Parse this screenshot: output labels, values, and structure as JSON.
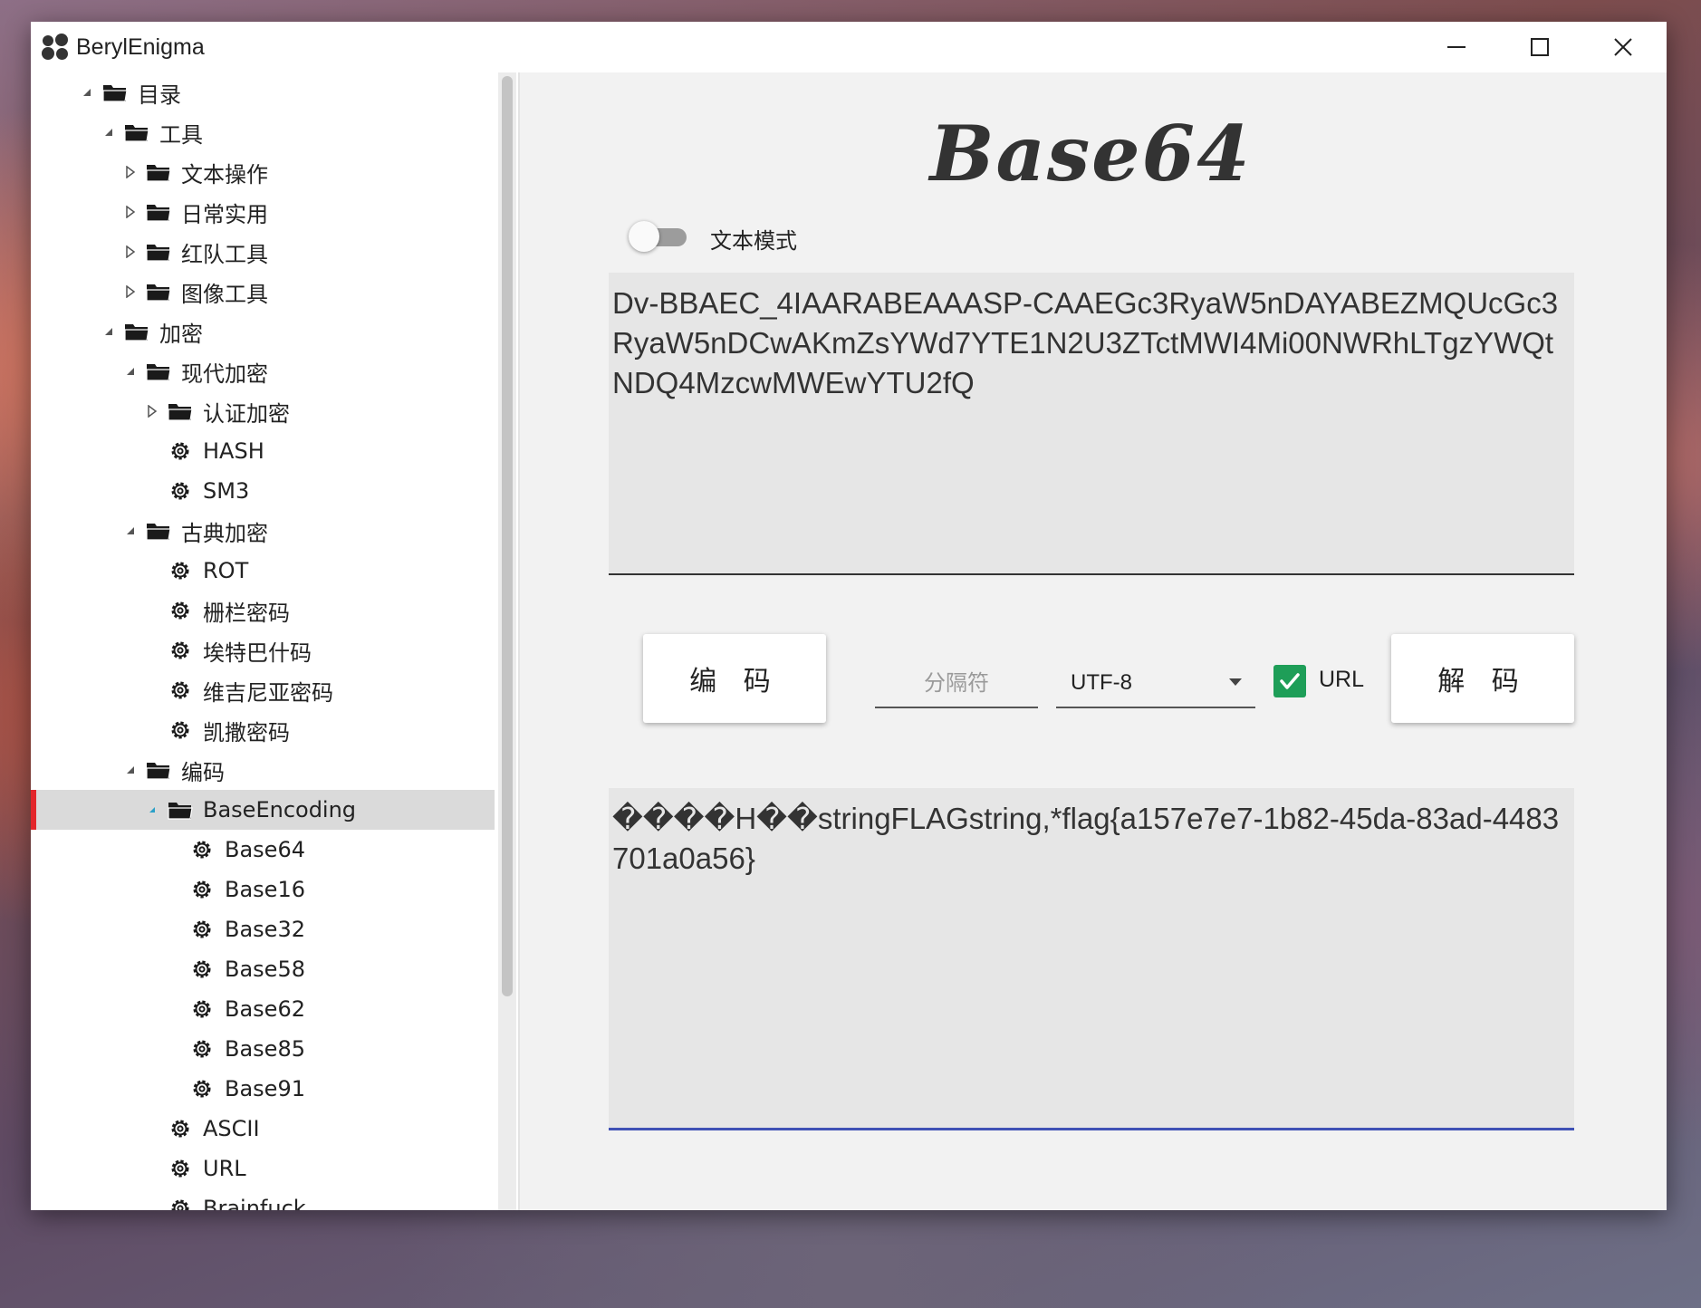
{
  "app": {
    "title": "BerylEnigma"
  },
  "sidebar": {
    "tree": [
      {
        "label": "目录",
        "depth": 0,
        "kind": "folder",
        "expander": "expanded"
      },
      {
        "label": "工具",
        "depth": 1,
        "kind": "folder",
        "expander": "expanded"
      },
      {
        "label": "文本操作",
        "depth": 2,
        "kind": "folder",
        "expander": "collapsed"
      },
      {
        "label": "日常实用",
        "depth": 2,
        "kind": "folder",
        "expander": "collapsed"
      },
      {
        "label": "红队工具",
        "depth": 2,
        "kind": "folder",
        "expander": "collapsed"
      },
      {
        "label": "图像工具",
        "depth": 2,
        "kind": "folder",
        "expander": "collapsed"
      },
      {
        "label": "加密",
        "depth": 1,
        "kind": "folder",
        "expander": "expanded"
      },
      {
        "label": "现代加密",
        "depth": 2,
        "kind": "folder",
        "expander": "expanded"
      },
      {
        "label": "认证加密",
        "depth": 3,
        "kind": "folder",
        "expander": "collapsed"
      },
      {
        "label": "HASH",
        "depth": 3,
        "kind": "tool",
        "expander": "none"
      },
      {
        "label": "SM3",
        "depth": 3,
        "kind": "tool",
        "expander": "none"
      },
      {
        "label": "古典加密",
        "depth": 2,
        "kind": "folder",
        "expander": "expanded"
      },
      {
        "label": "ROT",
        "depth": 3,
        "kind": "tool",
        "expander": "none"
      },
      {
        "label": "栅栏密码",
        "depth": 3,
        "kind": "tool",
        "expander": "none"
      },
      {
        "label": "埃特巴什码",
        "depth": 3,
        "kind": "tool",
        "expander": "none"
      },
      {
        "label": "维吉尼亚密码",
        "depth": 3,
        "kind": "tool",
        "expander": "none"
      },
      {
        "label": "凯撒密码",
        "depth": 3,
        "kind": "tool",
        "expander": "none"
      },
      {
        "label": "编码",
        "depth": 2,
        "kind": "folder",
        "expander": "expanded"
      },
      {
        "label": "BaseEncoding",
        "depth": 3,
        "kind": "folder",
        "expander": "expanded",
        "selected": true
      },
      {
        "label": "Base64",
        "depth": 4,
        "kind": "tool",
        "expander": "none"
      },
      {
        "label": "Base16",
        "depth": 4,
        "kind": "tool",
        "expander": "none"
      },
      {
        "label": "Base32",
        "depth": 4,
        "kind": "tool",
        "expander": "none"
      },
      {
        "label": "Base58",
        "depth": 4,
        "kind": "tool",
        "expander": "none"
      },
      {
        "label": "Base62",
        "depth": 4,
        "kind": "tool",
        "expander": "none"
      },
      {
        "label": "Base85",
        "depth": 4,
        "kind": "tool",
        "expander": "none"
      },
      {
        "label": "Base91",
        "depth": 4,
        "kind": "tool",
        "expander": "none"
      },
      {
        "label": "ASCII",
        "depth": 3,
        "kind": "tool",
        "expander": "none"
      },
      {
        "label": "URL",
        "depth": 3,
        "kind": "tool",
        "expander": "none"
      },
      {
        "label": "Brainfuck",
        "depth": 3,
        "kind": "tool",
        "expander": "none"
      }
    ]
  },
  "main": {
    "heading": "Base64",
    "text_mode_label": "文本模式",
    "text_mode_on": false,
    "input_text": "Dv-BBAEC_4IAARABEAAASP-CAAEGc3RyaW5nDAYABEZMQUcGc3RyaW5nDCwAKmZsYWd7YTE1N2U3ZTctMWI4Mi00NWRhLTgzYWQtNDQ4MzcwMWEwYTU2fQ",
    "encode_label": "编 码",
    "decode_label": "解 码",
    "separator_placeholder": "分隔符",
    "separator_value": "",
    "encoding_value": "UTF-8",
    "url_label": "URL",
    "url_checked": true,
    "output_text": "����H��stringFLAGstring,*flag{a157e7e7-1b82-45da-83ad-4483701a0a56}"
  },
  "colors": {
    "selection_marker": "#e3262b",
    "checkbox": "#1e9e58",
    "output_underline": "#3f51b5"
  }
}
